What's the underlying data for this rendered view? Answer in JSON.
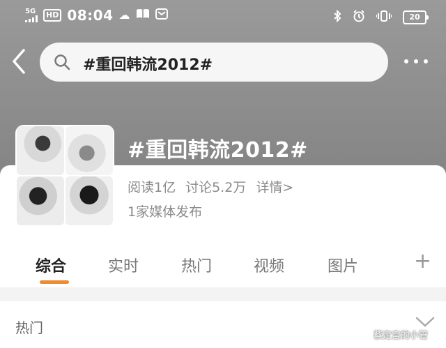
{
  "status_bar": {
    "network": "5G",
    "hd": "HD",
    "time": "08:04",
    "battery": "20"
  },
  "search": {
    "query": "#重回韩流2012#"
  },
  "topic": {
    "title": "#重回韩流2012#",
    "reads": "阅读1亿",
    "discussions": "讨论5.2万",
    "details": "详情>",
    "media": "1家媒体发布"
  },
  "tabs": [
    {
      "label": "综合"
    },
    {
      "label": "实时"
    },
    {
      "label": "热门"
    },
    {
      "label": "视频"
    },
    {
      "label": "图片"
    }
  ],
  "tabs_plus": "+",
  "section": {
    "label": "热门"
  },
  "watermark": "蔡定宫的小管",
  "colors": {
    "accent": "#f08a2c",
    "header_bg": "#8e8e8e"
  }
}
